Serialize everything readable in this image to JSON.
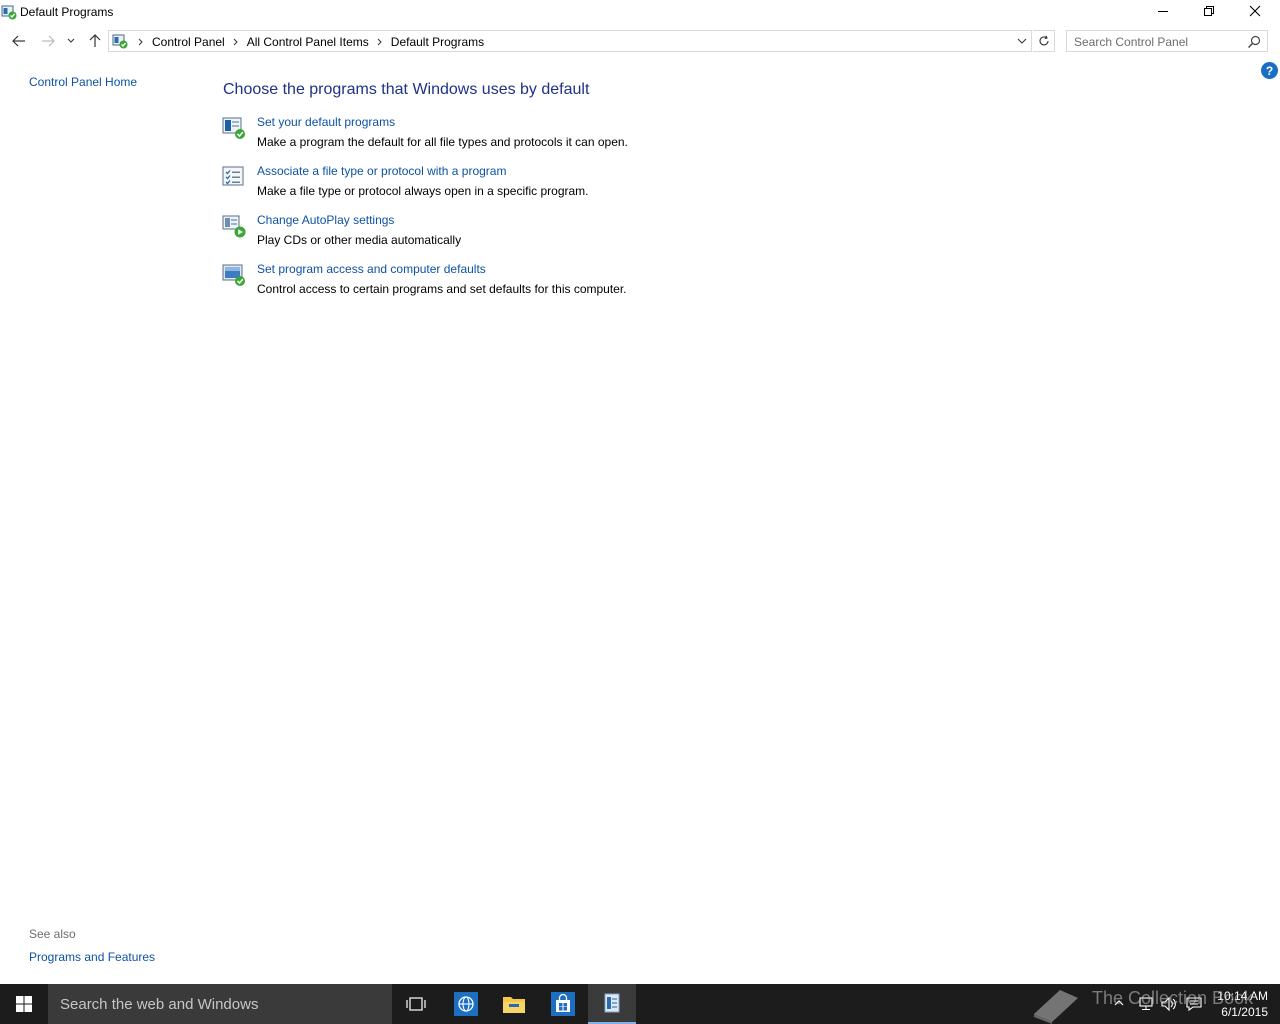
{
  "window": {
    "title": "Default Programs",
    "buttons": {
      "minimize": "minimize",
      "maximize": "restore",
      "close": "close"
    }
  },
  "nav": {
    "breadcrumbs": [
      "Control Panel",
      "All Control Panel Items",
      "Default Programs"
    ],
    "search_placeholder": "Search Control Panel"
  },
  "help_label": "?",
  "left_pane": {
    "home_link": "Control Panel Home",
    "see_also_title": "See also",
    "see_also_links": [
      "Programs and Features"
    ]
  },
  "main": {
    "title": "Choose the programs that Windows uses by default",
    "tasks": [
      {
        "link": "Set your default programs",
        "desc": "Make a program the default for all file types and protocols it can open.",
        "icon": "default-programs-icon"
      },
      {
        "link": "Associate a file type or protocol with a program",
        "desc": "Make a file type or protocol always open in a specific program.",
        "icon": "file-association-icon"
      },
      {
        "link": "Change AutoPlay settings",
        "desc": "Play CDs or other media automatically",
        "icon": "autoplay-icon"
      },
      {
        "link": "Set program access and computer defaults",
        "desc": "Control access to certain programs and set defaults for this computer.",
        "icon": "program-access-icon"
      }
    ]
  },
  "taskbar": {
    "search_placeholder": "Search the web and Windows",
    "clock_time": "10:14 AM",
    "clock_date": "6/1/2015",
    "watermark": "The Collection Book"
  },
  "colors": {
    "link": "#0d52a4",
    "title": "#1e3287",
    "taskbar": "#1c1c1c",
    "help": "#1a6fc4"
  }
}
